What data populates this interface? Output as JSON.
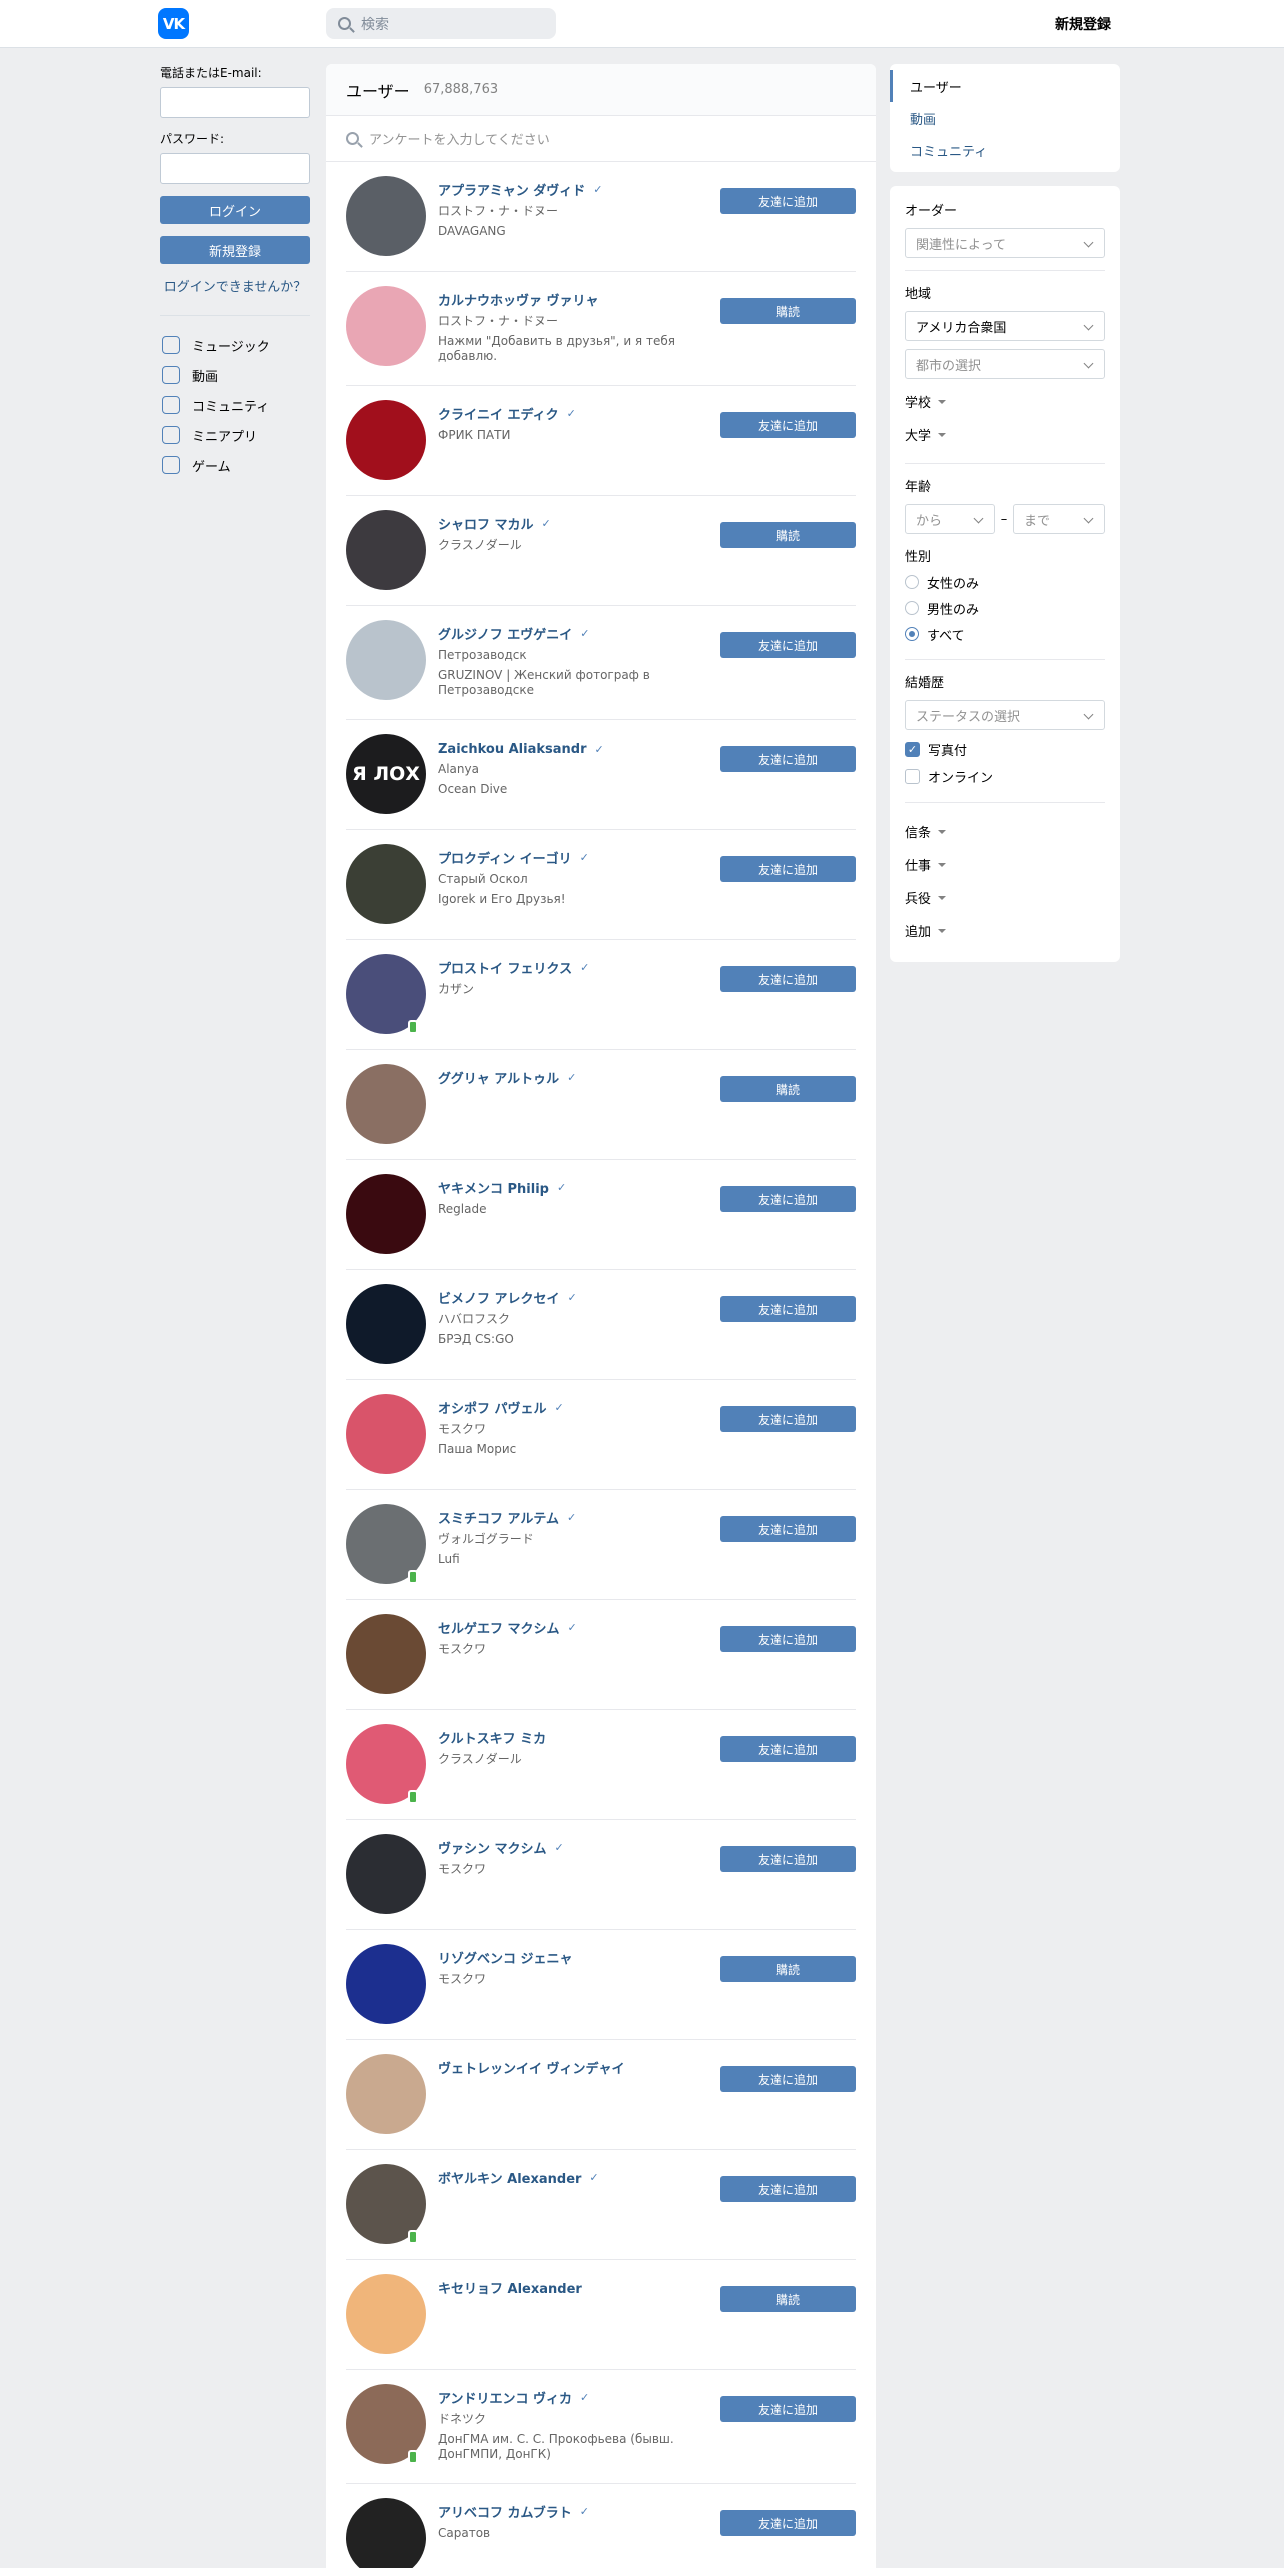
{
  "header": {
    "logo_text": "VK",
    "search_placeholder": "検索",
    "signup": "新規登録"
  },
  "login": {
    "phone_label": "電話またはE-mail:",
    "password_label": "パスワード:",
    "login_button": "ログイン",
    "signup_button": "新規登録",
    "forgot": "ログインできませんか？"
  },
  "left_nav": [
    {
      "label": "ミュージック",
      "icon": "music-icon"
    },
    {
      "label": "動画",
      "icon": "video-icon"
    },
    {
      "label": "コミュニティ",
      "icon": "community-icon"
    },
    {
      "label": "ミニアプリ",
      "icon": "mini-apps-icon"
    },
    {
      "label": "ゲーム",
      "icon": "gamepad-icon"
    }
  ],
  "main": {
    "title": "ユーザー",
    "count": "67,888,763",
    "search_placeholder": "アンケートを入力してください",
    "people": [
      {
        "name": "アプラアミャン ダヴィド",
        "verified": true,
        "lines": [
          "ロストフ・ナ・ドヌー",
          "DAVAGANG"
        ],
        "action": "友達に追加",
        "avatar": "#5a5f66",
        "mobile": false
      },
      {
        "name": "カルナウホッヴァ ヴァリャ",
        "verified": false,
        "lines": [
          "ロストフ・ナ・ドヌー",
          "Нажми \"Добавить в друзья\", и я тебя добавлю."
        ],
        "action": "購読",
        "avatar": "#e9a6b4",
        "mobile": false
      },
      {
        "name": "クライニイ エディク",
        "verified": true,
        "lines": [
          "ФРИК ПАТИ"
        ],
        "action": "友達に追加",
        "avatar": "#a10f1c",
        "mobile": false
      },
      {
        "name": "シャロフ マカル",
        "verified": true,
        "lines": [
          "クラスノダール"
        ],
        "action": "購読",
        "avatar": "#3d3a3f",
        "mobile": false
      },
      {
        "name": "グルジノフ エヴゲニイ",
        "verified": true,
        "lines": [
          "Петрозаводск",
          "GRUZINOV | Женский фотограф в Петрозаводске"
        ],
        "action": "友達に追加",
        "avatar": "#b9c3cc",
        "mobile": false
      },
      {
        "name": "Zaichkou Aliaksandr",
        "verified": true,
        "lines": [
          "Alanya",
          "Ocean Dive"
        ],
        "action": "友達に追加",
        "avatar": "#1c1c1e",
        "avatar_text": "Я ЛОХ",
        "mobile": false
      },
      {
        "name": "プロクディン イーゴリ",
        "verified": true,
        "lines": [
          "Старый Оскол",
          "Igorek и Его Друзья!"
        ],
        "action": "友達に追加",
        "avatar": "#3b3f35",
        "mobile": false
      },
      {
        "name": "プロストイ フェリクス",
        "verified": true,
        "lines": [
          "カザン"
        ],
        "action": "友達に追加",
        "avatar": "#4a4e7a",
        "mobile": true
      },
      {
        "name": "ググリャ アルトゥル",
        "verified": true,
        "lines": [],
        "action": "購読",
        "avatar": "#8a6f63",
        "mobile": false
      },
      {
        "name": "ヤキメンコ Philip",
        "verified": true,
        "lines": [
          "Reglade"
        ],
        "action": "友達に追加",
        "avatar": "#3a0a10",
        "mobile": false
      },
      {
        "name": "ビメノフ アレクセイ",
        "verified": true,
        "lines": [
          "ハバロフスク",
          "БРЭД CS:GO"
        ],
        "action": "友達に追加",
        "avatar": "#0f1a2a",
        "mobile": false
      },
      {
        "name": "オシポフ パヴェル",
        "verified": true,
        "lines": [
          "モスクワ",
          "Паша Морис"
        ],
        "action": "友達に追加",
        "avatar": "#d9546a",
        "mobile": false
      },
      {
        "name": "スミチコフ アルテム",
        "verified": true,
        "lines": [
          "ヴォルゴグラード",
          "Lufi"
        ],
        "action": "友達に追加",
        "avatar": "#6b6f72",
        "mobile": true
      },
      {
        "name": "セルゲエフ マクシム",
        "verified": true,
        "lines": [
          "モスクワ"
        ],
        "action": "友達に追加",
        "avatar": "#6a4a34",
        "mobile": false
      },
      {
        "name": "クルトスキフ ミカ",
        "verified": false,
        "lines": [
          "クラスノダール"
        ],
        "action": "友達に追加",
        "avatar": "#e05a74",
        "mobile": true
      },
      {
        "name": "ヴァシン マクシム",
        "verified": true,
        "lines": [
          "モスクワ"
        ],
        "action": "友達に追加",
        "avatar": "#2b2d33",
        "mobile": false
      },
      {
        "name": "リゾグベンコ ジェニャ",
        "verified": false,
        "lines": [
          "モスクワ"
        ],
        "action": "購読",
        "avatar": "#1c2f8f",
        "mobile": false
      },
      {
        "name": "ヴェトレッンイイ ヴィンデャイ",
        "verified": false,
        "lines": [],
        "action": "友達に追加",
        "avatar": "#c9a98f",
        "mobile": false
      },
      {
        "name": "ボヤルキン Alexander",
        "verified": true,
        "lines": [],
        "action": "友達に追加",
        "avatar": "#5c544c",
        "mobile": true
      },
      {
        "name": "キセリョフ Alexander",
        "verified": false,
        "lines": [],
        "action": "購読",
        "avatar": "#f0b57a",
        "mobile": false
      },
      {
        "name": "アンドリエンコ ヴィカ",
        "verified": true,
        "lines": [
          "ドネツク",
          "ДонГМА им. С. С. Прокофьева (бывш. ДонГМПИ, ДонГК)"
        ],
        "action": "友達に追加",
        "avatar": "#8c6a58",
        "mobile": true
      },
      {
        "name": "アリベコフ カムブラト",
        "verified": true,
        "lines": [
          "Саратов"
        ],
        "action": "友達に追加",
        "avatar": "#222222",
        "mobile": false
      }
    ]
  },
  "right_nav": {
    "items": [
      "ユーザー",
      "動画",
      "コミュニティ"
    ],
    "active": 0
  },
  "filters": {
    "order_label": "オーダー",
    "order_value": "関連性によって",
    "region_label": "地域",
    "country": "アメリカ合衆国",
    "city_placeholder": "都市の選択",
    "school": "学校",
    "university": "大学",
    "age_label": "年齢",
    "age_from": "から",
    "age_dash": "–",
    "age_to": "まで",
    "gender_label": "性別",
    "gender_options": [
      "女性のみ",
      "男性のみ",
      "すべて"
    ],
    "gender_selected": 2,
    "marital_label": "結婚歴",
    "marital_placeholder": "ステータスの選択",
    "with_photo": "写真付",
    "with_photo_checked": true,
    "online": "オンライン",
    "online_checked": false,
    "expanders": [
      "信条",
      "仕事",
      "兵役",
      "追加"
    ]
  }
}
